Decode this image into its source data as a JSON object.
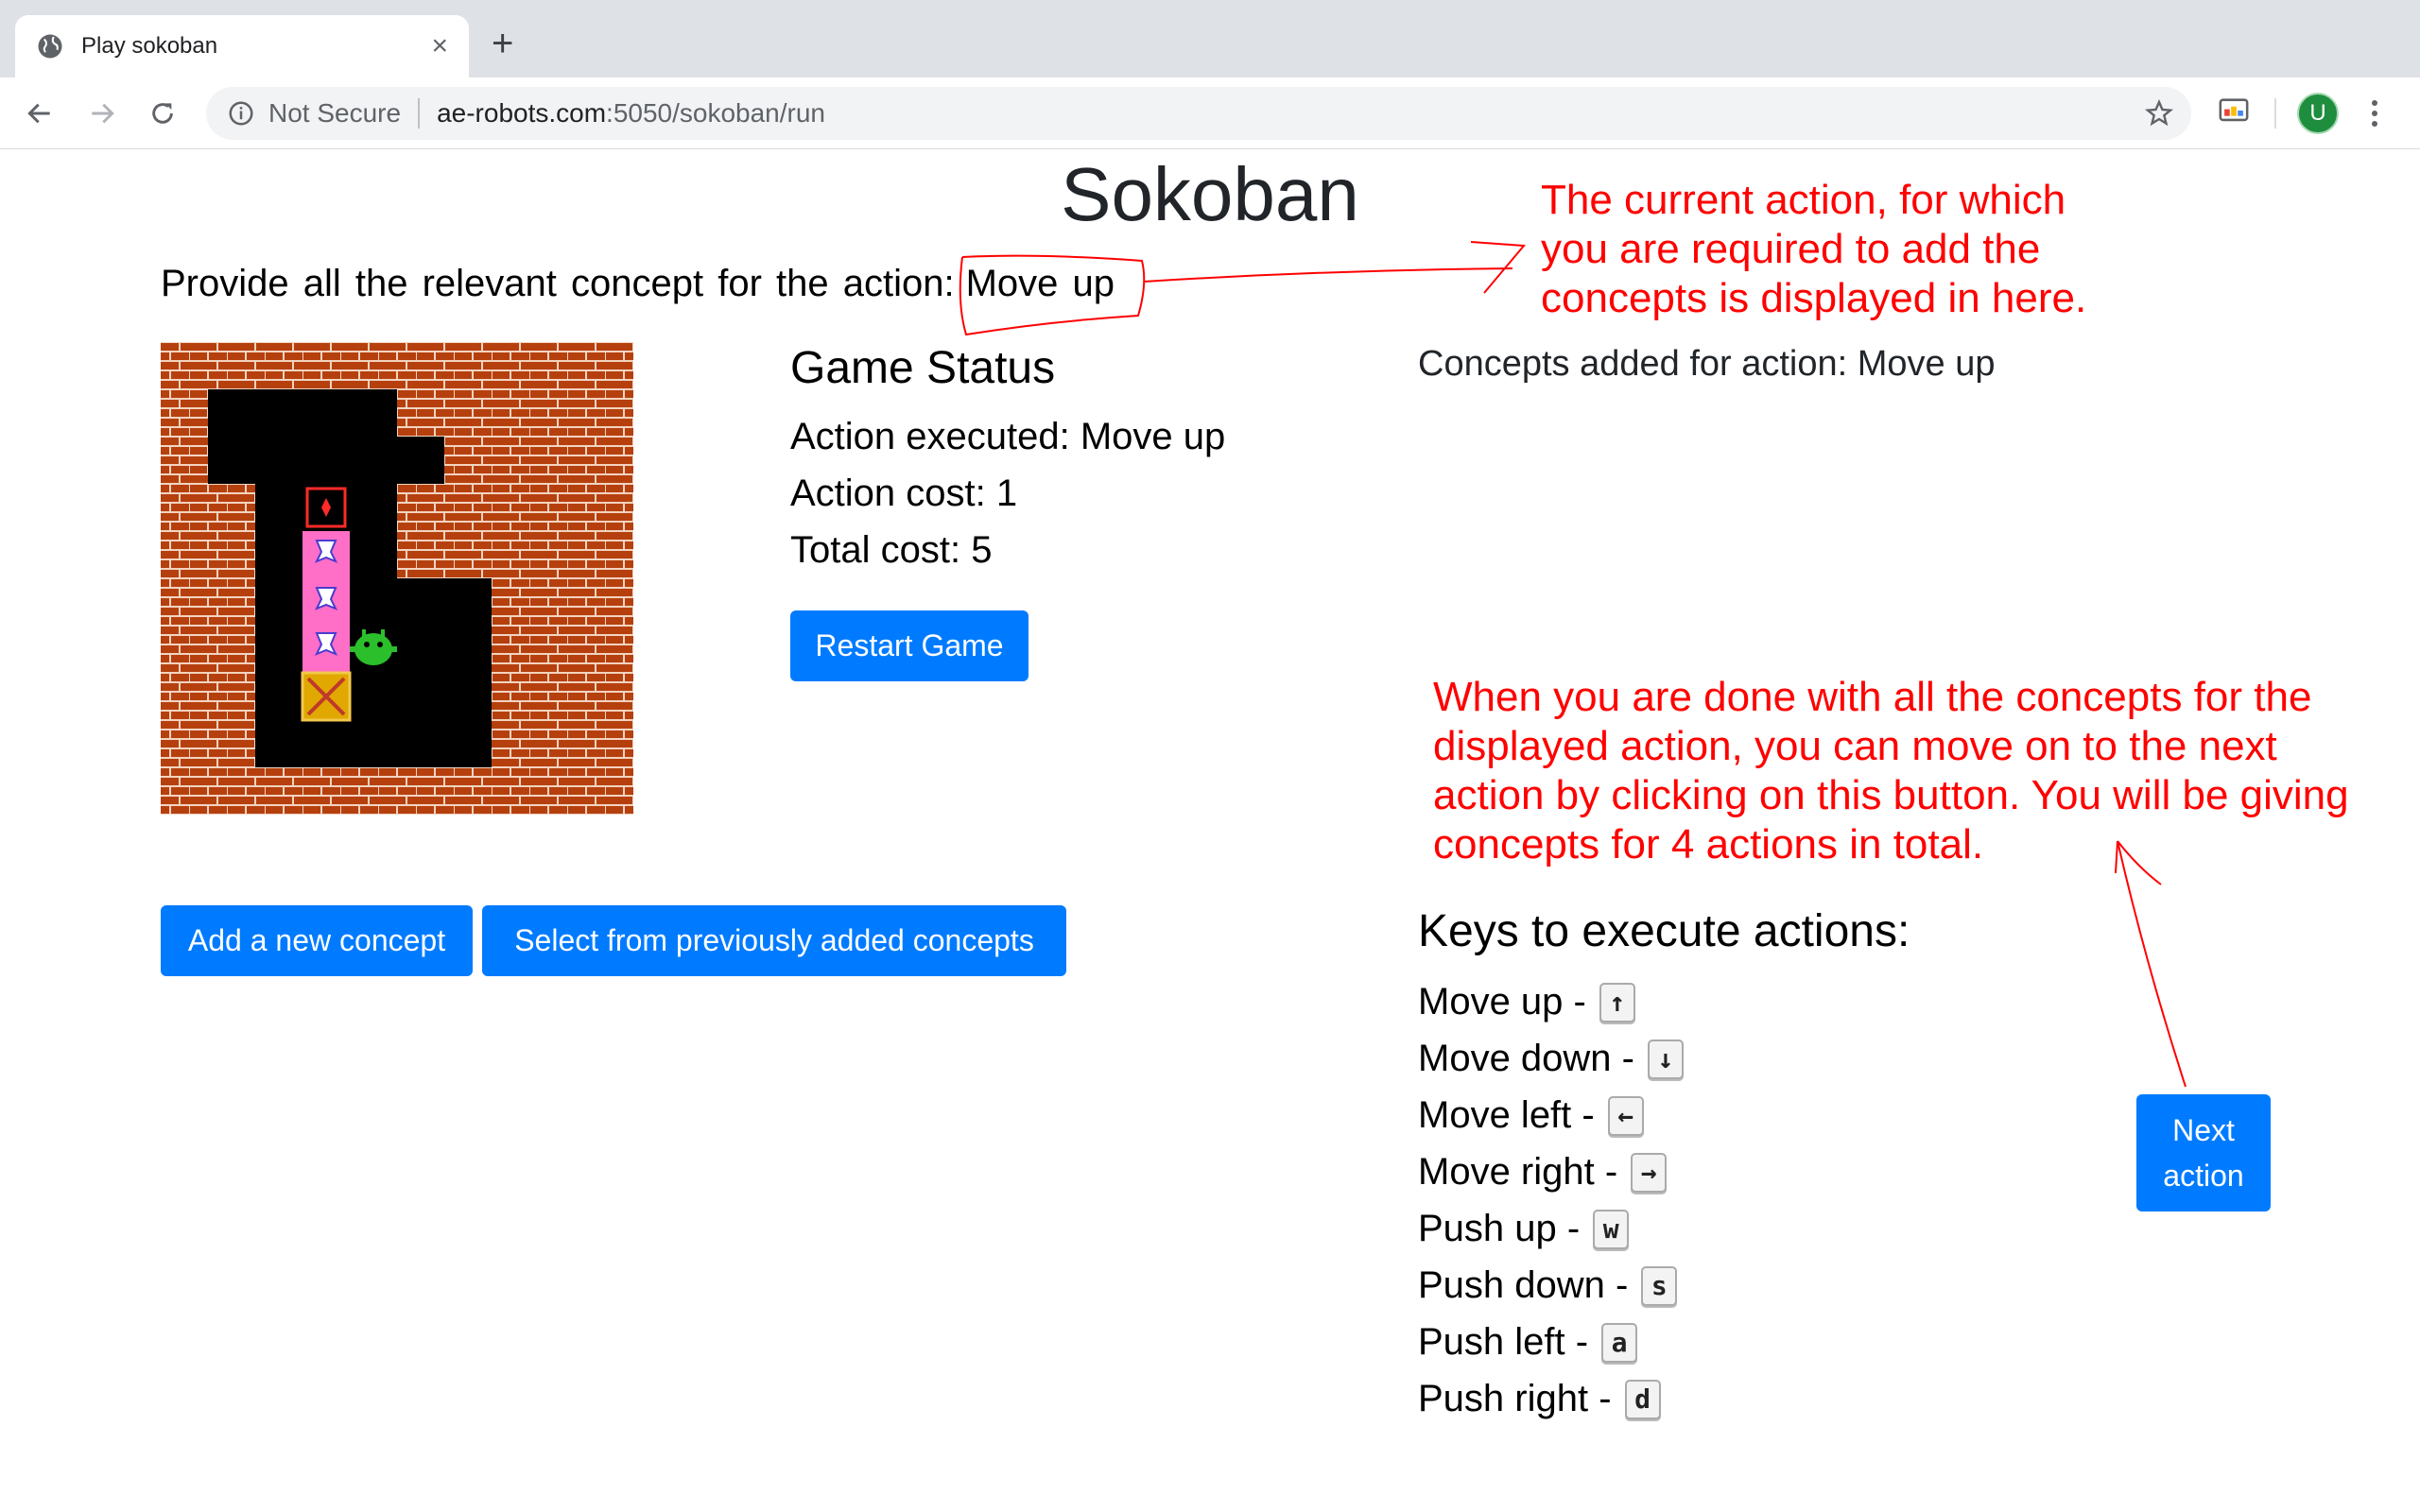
{
  "browser": {
    "tab_title": "Play sokoban",
    "new_tab_symbol": "+",
    "close_symbol": "×",
    "security_label": "Not Secure",
    "url_host": "ae-robots.com",
    "url_path": ":5050/sokoban/run",
    "profile_initial": "U"
  },
  "page": {
    "title": "Sokoban",
    "instruction": "Provide all the relevant concept for the action:",
    "current_action": "Move up"
  },
  "game_status": {
    "heading": "Game Status",
    "action_executed": "Action executed: Move up",
    "action_cost": "Action cost: 1",
    "total_cost": "Total cost: 5",
    "restart_label": "Restart Game"
  },
  "concept_buttons": {
    "add_label": "Add a new concept",
    "select_label": "Select from previously added concepts"
  },
  "concepts_panel": {
    "heading": "Concepts added for action: Move up"
  },
  "annotations": {
    "action_note": "The current action, for which you are required to add the concepts is displayed in here.",
    "next_note": "When you are done with all the concepts for the displayed action, you can move on to the next action by clicking on this button. You will be giving concepts for 4 actions in total."
  },
  "keys": {
    "heading": "Keys to execute actions:",
    "items": [
      {
        "label": "Move up -",
        "key": "↑"
      },
      {
        "label": "Move down -",
        "key": "↓"
      },
      {
        "label": "Move left -",
        "key": "←"
      },
      {
        "label": "Move right -",
        "key": "→"
      },
      {
        "label": "Push up -",
        "key": "w"
      },
      {
        "label": "Push down -",
        "key": "s"
      },
      {
        "label": "Push left -",
        "key": "a"
      },
      {
        "label": "Push right -",
        "key": "d"
      }
    ]
  },
  "next_button": {
    "line1": "Next",
    "line2": "action"
  },
  "colors": {
    "primary": "#007bff",
    "annotation": "#ff0000",
    "brick": "#b5400e",
    "mortar": "#f3d3c0",
    "floor": "#000000",
    "player": "#2bbf2b",
    "crate": "#e0a800",
    "goal_tile": "#ff6ec7"
  }
}
